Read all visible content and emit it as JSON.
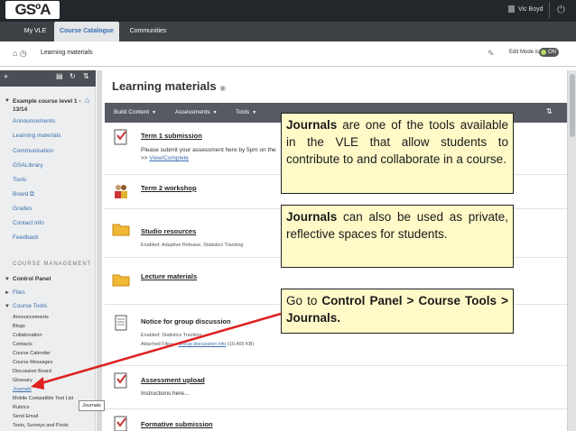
{
  "topbar": {
    "logo": "GSºA",
    "user": "Vic Boyd"
  },
  "nav": {
    "tabs": [
      "My VLE",
      "Course Catalogue",
      "Communities"
    ]
  },
  "breadcrumb": {
    "crumb": "Learning materials",
    "edit_mode_label": "Edit Mode is:",
    "edit_mode_value": "ON"
  },
  "sidebar": {
    "course": "Example course level 1 - 13/14",
    "links": [
      "Announcements",
      "Learning materials",
      "Communication",
      "GSALibrary",
      "Tools",
      "Board ⧉",
      "Grades",
      "Contact info",
      "Feedback"
    ],
    "mgmt_heading": "COURSE MANAGEMENT",
    "control_panel": "Control Panel",
    "files": "Files",
    "course_tools": "Course Tools",
    "tools": [
      "Announcements",
      "Blogs",
      "Collaboration",
      "Contacts",
      "Course Calendar",
      "Course Messages",
      "Discussion Board",
      "Glossary",
      "Journals",
      "Mobile Compatible Test List",
      "Rubrics",
      "Send Email",
      "Tests, Surveys and Pools"
    ],
    "tooltip": "Journals"
  },
  "content": {
    "title": "Learning materials",
    "toolbar": {
      "build": "Build Content",
      "assess": "Assessments",
      "tools": "Tools"
    },
    "items": [
      {
        "title": "Term 1 submission",
        "line1": "Please submit your assessment here by 5pm on the",
        "line2_prefix": ">> ",
        "line2_link": "View/Complete"
      },
      {
        "title": "Term 2 workshop"
      },
      {
        "title": "Studio resources",
        "meta_label": "Enabled:",
        "meta": "Adaptive Release, Statistics Tracking"
      },
      {
        "title": "Lecture materials"
      },
      {
        "title": "Notice for group discussion",
        "meta_label": "Enabled:",
        "meta": "Statistics Tracking",
        "attached_label": "Attached Files:",
        "attached_file": "Group discussion info",
        "attached_size": "(10.465 KB)"
      },
      {
        "title": "Assessment upload",
        "line1": "Instructions here..."
      },
      {
        "title": "Formative submission"
      }
    ]
  },
  "callouts": {
    "c1_bold": "Journals",
    "c1_rest": " are one of the tools available in the VLE that allow students to contribute to and collaborate in a course.",
    "c2_bold": "Journals",
    "c2_rest": " can also be used as private, reflective spaces for students.",
    "c3_a": "Go to ",
    "c3_b": "Control Panel > Course Tools > Journals."
  },
  "colors": {
    "accent": "#3b6db1",
    "callout_yellow": "#fffac8",
    "arrow": "#e02020",
    "topbar": "#23262a"
  }
}
